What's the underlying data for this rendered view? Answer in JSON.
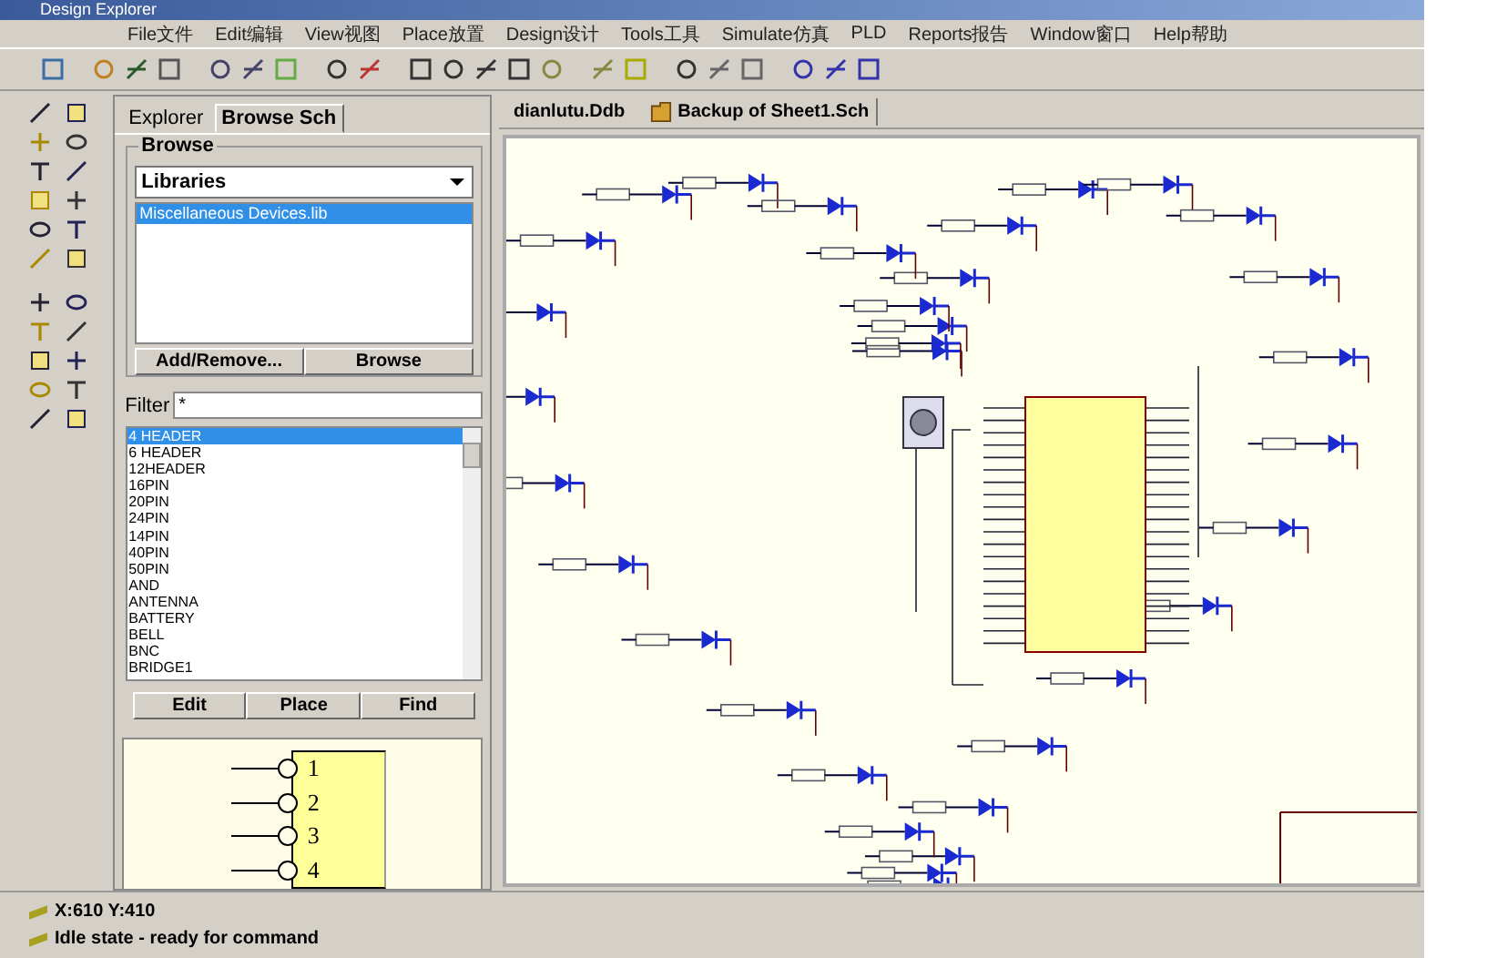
{
  "window": {
    "title": "Design Explorer"
  },
  "menu": [
    {
      "label": "File文件"
    },
    {
      "label": "Edit编辑"
    },
    {
      "label": "View视图"
    },
    {
      "label": "Place放置"
    },
    {
      "label": "Design设计"
    },
    {
      "label": "Tools工具"
    },
    {
      "label": "Simulate仿真"
    },
    {
      "label": "PLD"
    },
    {
      "label": "Reports报告"
    },
    {
      "label": "Window窗口"
    },
    {
      "label": "Help帮助"
    }
  ],
  "panel": {
    "tabs": [
      {
        "label": "Explorer",
        "selected": false
      },
      {
        "label": "Browse Sch",
        "selected": true
      }
    ],
    "group_label": "Browse",
    "browse_select": "Libraries",
    "libraries": [
      {
        "label": "Miscellaneous Devices.lib",
        "selected": true
      }
    ],
    "library_buttons": [
      "Add/Remove...",
      "Browse"
    ],
    "filter": {
      "label": "Filter",
      "value": "*"
    },
    "components": [
      {
        "label": "4 HEADER",
        "selected": true
      },
      {
        "label": "6 HEADER",
        "selected": false
      },
      {
        "label": "12HEADER",
        "selected": false
      },
      {
        "label": "16PIN",
        "selected": false
      },
      {
        "label": "20PIN",
        "selected": false
      },
      {
        "label": "24PIN",
        "selected": false
      },
      {
        "label": "14PIN",
        "selected": false
      },
      {
        "label": "40PIN",
        "selected": false
      },
      {
        "label": "50PIN",
        "selected": false
      },
      {
        "label": "AND",
        "selected": false
      },
      {
        "label": "ANTENNA",
        "selected": false
      },
      {
        "label": "BATTERY",
        "selected": false
      },
      {
        "label": "BELL",
        "selected": false
      },
      {
        "label": "BNC",
        "selected": false
      },
      {
        "label": "BRIDGE1",
        "selected": false
      }
    ],
    "component_buttons": [
      "Edit",
      "Place",
      "Find"
    ],
    "preview": {
      "pins": [
        "1",
        "2",
        "3",
        "4"
      ]
    }
  },
  "documents": {
    "tabs": [
      {
        "label": "dianlutu.Ddb",
        "selected": false,
        "kind": "database"
      },
      {
        "label": "Backup of Sheet1.Sch",
        "selected": true,
        "kind": "sheet"
      }
    ]
  },
  "status_bar": {
    "coordinates": "X:610 Y:410",
    "message": "Idle state - ready for command"
  }
}
